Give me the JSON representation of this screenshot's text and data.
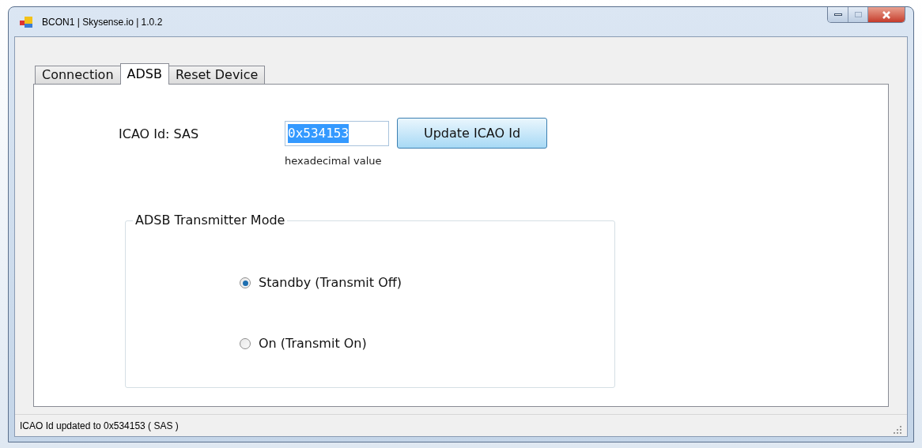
{
  "window": {
    "title": "BCON1 | Skysense.io | 1.0.2"
  },
  "tabs": [
    {
      "label": "Connection",
      "selected": false
    },
    {
      "label": "ADSB",
      "selected": true
    },
    {
      "label": "Reset Device",
      "selected": false
    }
  ],
  "icao": {
    "label": "ICAO Id: SAS",
    "value": "0x534153",
    "text_selected": true,
    "hint": "hexadecimal value",
    "button": "Update ICAO Id"
  },
  "transmitter_mode": {
    "title": "ADSB Transmitter Mode",
    "options": [
      {
        "label": "Standby (Transmit Off)",
        "selected": true
      },
      {
        "label": "On (Transmit On)",
        "selected": false
      }
    ]
  },
  "status_bar": "ICAO Id updated to 0x534153 ( SAS )"
}
